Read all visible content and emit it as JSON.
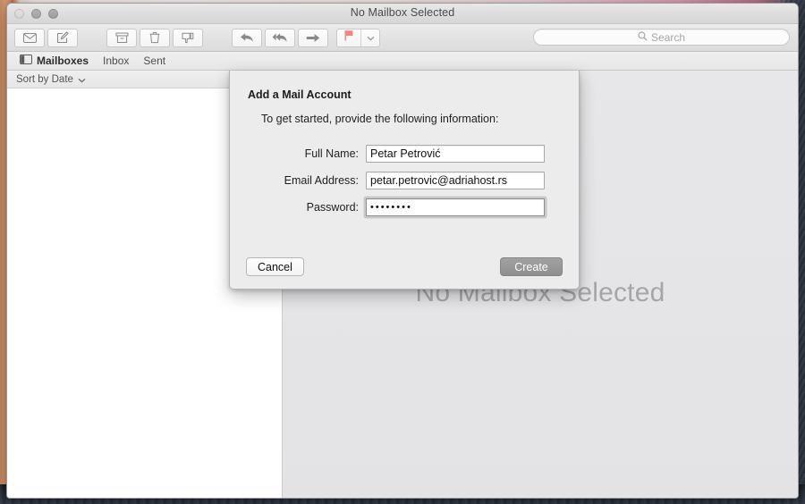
{
  "window": {
    "title": "No Mailbox Selected",
    "traffic_lights": [
      "close",
      "minimize",
      "maximize"
    ]
  },
  "toolbar": {
    "buttons": [
      {
        "name": "get-mail-button",
        "icon": "envelope-icon"
      },
      {
        "name": "compose-button",
        "icon": "compose-icon"
      },
      {
        "name": "archive-button",
        "icon": "archive-icon"
      },
      {
        "name": "delete-button",
        "icon": "trash-icon"
      },
      {
        "name": "junk-button",
        "icon": "junk-thumbs-down-icon"
      },
      {
        "name": "reply-button",
        "icon": "reply-arrow-icon"
      },
      {
        "name": "reply-all-button",
        "icon": "reply-all-arrow-icon"
      },
      {
        "name": "forward-button",
        "icon": "forward-arrow-icon"
      },
      {
        "name": "flag-button",
        "icon": "flag-icon"
      },
      {
        "name": "flag-menu-button",
        "icon": "chevron-down-icon"
      }
    ],
    "flag_color": "#f4827f"
  },
  "search": {
    "placeholder": "Search",
    "value": "",
    "icon": "search-icon"
  },
  "favorites": {
    "items": [
      {
        "label": "Mailboxes",
        "icon": "sidebar-toggle-icon",
        "active": true
      },
      {
        "label": "Inbox",
        "active": false
      },
      {
        "label": "Sent",
        "active": false
      }
    ]
  },
  "message_list": {
    "sort_label": "Sort by Date",
    "sort_icon": "chevron-down-icon",
    "items": []
  },
  "content": {
    "empty_message": "No Mailbox Selected"
  },
  "sheet": {
    "title": "Add a Mail Account",
    "subtitle": "To get started, provide the following information:",
    "fields": [
      {
        "label": "Full Name:",
        "value": "Petar Petrović",
        "type": "text",
        "focused": false
      },
      {
        "label": "Email Address:",
        "value": "petar.petrovic@adriahost.rs",
        "type": "text",
        "focused": false
      },
      {
        "label": "Password:",
        "value": "••••••••",
        "type": "password",
        "focused": true
      }
    ],
    "cancel_label": "Cancel",
    "create_label": "Create"
  }
}
